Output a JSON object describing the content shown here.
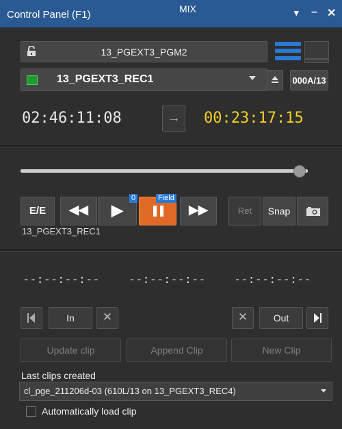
{
  "window": {
    "title": "Control Panel (F1)",
    "mode": "MIX",
    "controls": {
      "menu": "▾",
      "minimize": "–",
      "close": "✕"
    }
  },
  "source": {
    "channel_label": "13_PGEXT3_PGM2",
    "recorder_label": "13_PGEXT3_REC1",
    "counter": "000A/13"
  },
  "timecodes": {
    "current": "02:46:11:08",
    "arrow": "→",
    "remaining": "00:23:17:15"
  },
  "slider": {
    "position": 0.97
  },
  "transport": {
    "ee_label": "E/E",
    "rewind": "◀◀",
    "play": "▶",
    "ff": "▶▶",
    "play_badge": "0",
    "pause_badge": "Field",
    "ret_label": "Ret",
    "snap_label": "Snap",
    "source_name": "13_PGEXT3_REC1"
  },
  "marks": {
    "in_tc": "--:--:--:--",
    "mid_tc": "--:--:--:--",
    "out_tc": "--:--:--:--",
    "in_label": "In",
    "out_label": "Out",
    "clear": "✕"
  },
  "clip_actions": {
    "update": "Update clip",
    "append": "Append Clip",
    "new": "New Clip"
  },
  "last_clips": {
    "label": "Last clips created",
    "selected": "cl_pge_211206d-03 (610L/13 on 13_PGEXT3_REC4)"
  },
  "auto_load": {
    "label": "Automatically load clip",
    "checked": false
  },
  "colors": {
    "titlebar": "#2a5a93",
    "accent_blue": "#2a7ad5",
    "pause_orange": "#e06a25",
    "timecode_yellow": "#f2d024"
  }
}
